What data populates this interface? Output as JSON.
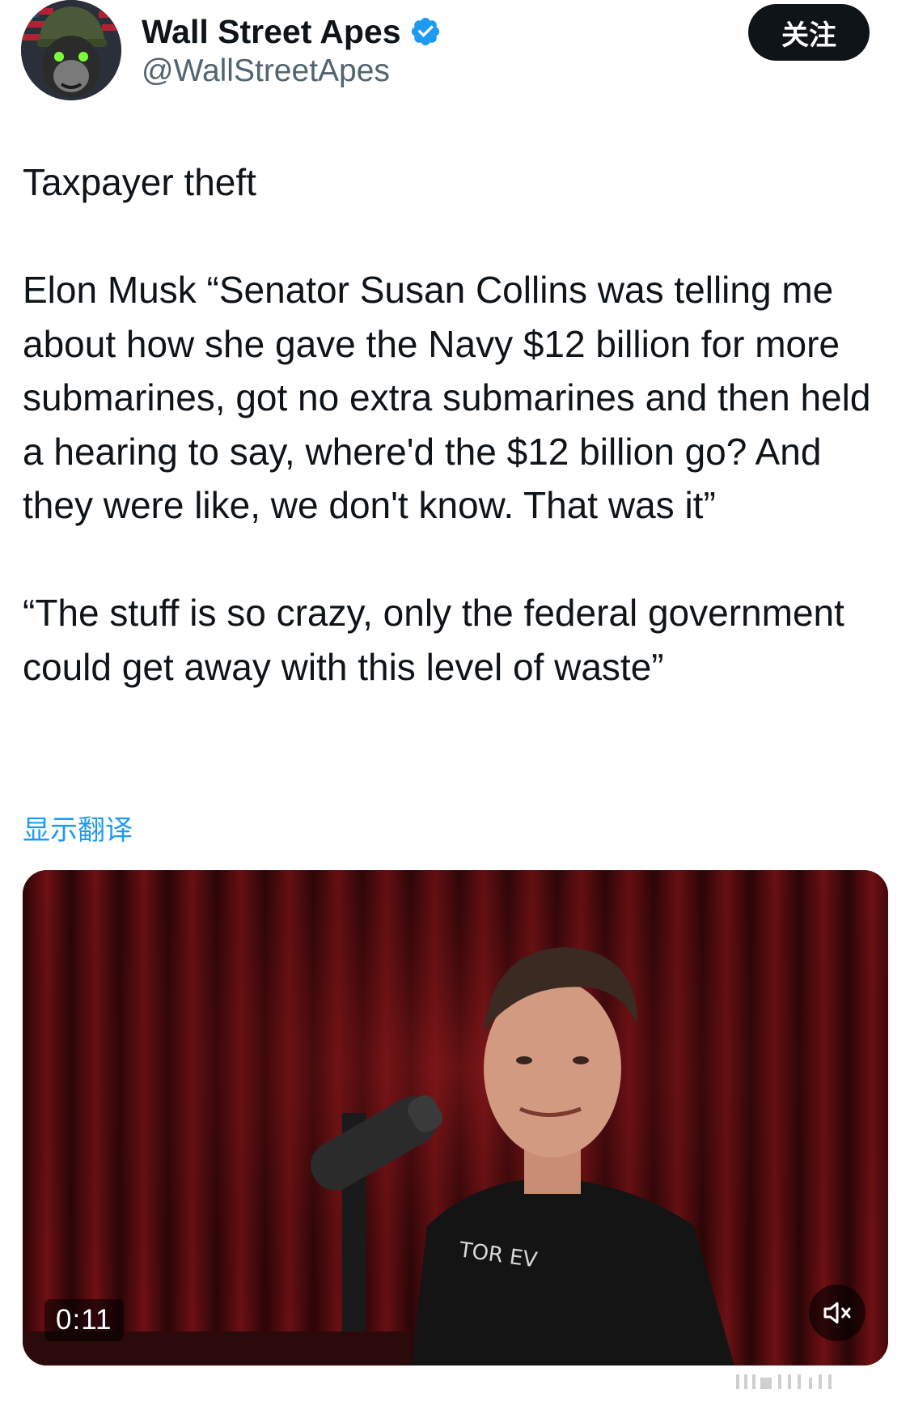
{
  "author": {
    "display_name": "Wall Street Apes",
    "handle": "@WallStreetApes",
    "verified": true,
    "avatar_icon": "ape-soldier-avatar"
  },
  "follow_button": {
    "label": "关注"
  },
  "tweet": {
    "paragraphs": [
      "Taxpayer theft",
      "Elon Musk “Senator Susan Collins was telling me about how she gave the Navy $12 billion for more submarines, got no extra submarines and then held a hearing to say, where'd the $12 billion go? And they were like, we don't know. That was it”",
      "“The stuff is so crazy, only the federal government could get away with this level of waste”"
    ],
    "translate_label": "显示翻译"
  },
  "video": {
    "duration": "0:11",
    "mute_icon": "speaker-muted-icon",
    "shirt_text": "TOR EV"
  },
  "colors": {
    "text_primary": "#0f1419",
    "text_secondary": "#536471",
    "link": "#1d9bf0",
    "verified_badge": "#1d9bf0",
    "follow_bg": "#0f1419"
  }
}
